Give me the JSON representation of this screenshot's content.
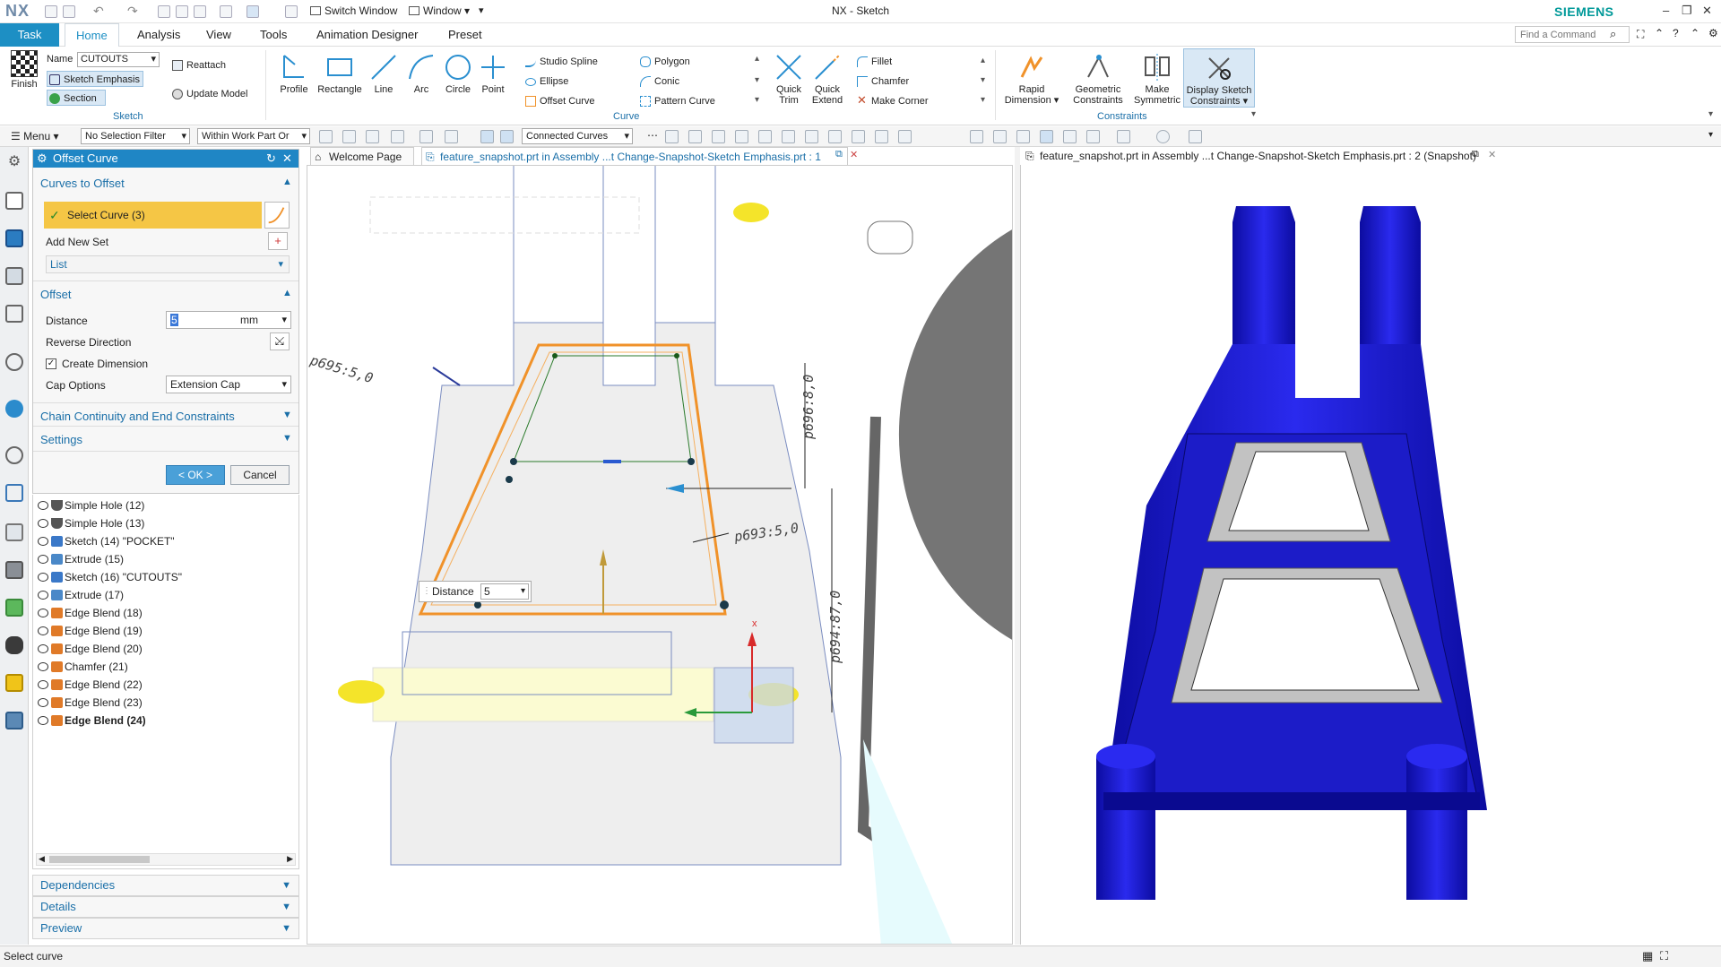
{
  "app": {
    "logo": "NX",
    "title": "NX - Sketch",
    "brand": "SIEMENS",
    "switch_window": "Switch Window",
    "window_menu": "Window"
  },
  "ribbon_tabs": {
    "task": "Task",
    "items": [
      "Home",
      "Analysis",
      "View",
      "Tools",
      "Animation Designer",
      "Preset"
    ],
    "active": "Home",
    "find_placeholder": "Find a Command"
  },
  "ribbon": {
    "sketch_group": {
      "finish": "Finish",
      "name_label": "Name",
      "name_value": "CUTOUTS",
      "sketch_emphasis": "Sketch Emphasis",
      "section": "Section",
      "reattach": "Reattach",
      "update_model": "Update Model",
      "label": "Sketch"
    },
    "curve_group": {
      "profile": "Profile",
      "rectangle": "Rectangle",
      "line": "Line",
      "arc": "Arc",
      "circle": "Circle",
      "point": "Point",
      "studio_spline": "Studio Spline",
      "polygon": "Polygon",
      "ellipse": "Ellipse",
      "conic": "Conic",
      "offset_curve": "Offset Curve",
      "pattern_curve": "Pattern Curve",
      "quick_trim": "Quick Trim",
      "quick_extend": "Quick Extend",
      "fillet": "Fillet",
      "chamfer": "Chamfer",
      "make_corner": "Make Corner",
      "label": "Curve"
    },
    "constraints_group": {
      "rapid_dimension": "Rapid Dimension",
      "geometric_constraints": "Geometric Constraints",
      "make_symmetric": "Make Symmetric",
      "display_sketch_constraints": "Display Sketch Constraints",
      "label": "Constraints"
    }
  },
  "selection_bar": {
    "menu": "Menu",
    "selection_filter": "No Selection Filter",
    "scope": "Within Work Part Or",
    "curve_rule": "Connected Curves"
  },
  "dialog": {
    "title": "Offset Curve",
    "curves_section": "Curves to Offset",
    "select_curve": "Select Curve (3)",
    "add_new_set": "Add New Set",
    "list": "List",
    "offset_section": "Offset",
    "distance_label": "Distance",
    "distance_value": "5",
    "distance_unit": "mm",
    "reverse_direction": "Reverse Direction",
    "create_dimension": "Create Dimension",
    "cap_options_label": "Cap Options",
    "cap_options_value": "Extension Cap",
    "chain_section": "Chain Continuity and End Constraints",
    "settings_section": "Settings",
    "ok": "< OK >",
    "cancel": "Cancel"
  },
  "part_navigator": {
    "rows": [
      {
        "label": "Simple Hole (12)",
        "type": "hole"
      },
      {
        "label": "Simple Hole (13)",
        "type": "hole"
      },
      {
        "label": "Sketch (14) \"POCKET\"",
        "type": "sketch"
      },
      {
        "label": "Extrude (15)",
        "type": "extrude"
      },
      {
        "label": "Sketch (16) \"CUTOUTS\"",
        "type": "sketch"
      },
      {
        "label": "Extrude (17)",
        "type": "extrude"
      },
      {
        "label": "Edge Blend (18)",
        "type": "blend"
      },
      {
        "label": "Edge Blend (19)",
        "type": "blend"
      },
      {
        "label": "Edge Blend (20)",
        "type": "blend"
      },
      {
        "label": "Chamfer (21)",
        "type": "blend"
      },
      {
        "label": "Edge Blend (22)",
        "type": "blend"
      },
      {
        "label": "Edge Blend (23)",
        "type": "blend"
      },
      {
        "label": "Edge Blend (24)",
        "type": "blend"
      }
    ],
    "dependencies": "Dependencies",
    "details": "Details",
    "preview": "Preview"
  },
  "viewports": {
    "welcome_tab": "Welcome Page",
    "tab1": "feature_snapshot.prt in Assembly ...t Change-Snapshot-Sketch Emphasis.prt : 1",
    "tab2": "feature_snapshot.prt in Assembly ...t Change-Snapshot-Sketch Emphasis.prt : 2 (Snapshot)"
  },
  "sketch_annotations": {
    "dim_p695": "p695:5,0",
    "dim_p696": "p696:8,0",
    "dim_p693": "p693:5,0",
    "dim_p694": "p694:87,0",
    "onscreen_label": "Distance",
    "onscreen_value": "5"
  },
  "status": {
    "text": "Select curve"
  },
  "colors": {
    "accent": "#1f86c5",
    "select_highlight": "#f5c645",
    "model_blue": "#1a1ad6",
    "sketch_orange": "#f0922a"
  }
}
